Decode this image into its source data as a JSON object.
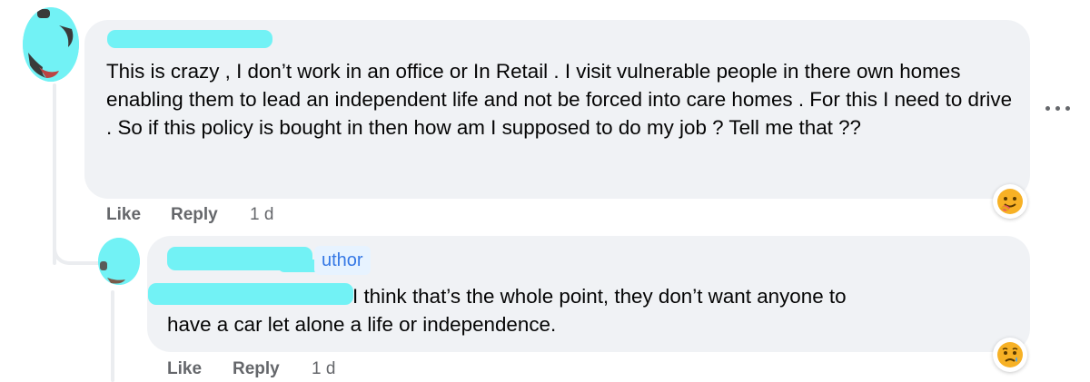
{
  "main_comment": {
    "text": "This is crazy , I don’t work in an office or In Retail . I visit vulnerable people in there own homes enabling them to lead an independent life and not be forced into care homes . For this I need to drive . So if this policy is bought in then how am I supposed to do my job ? Tell me that ??",
    "like_label": "Like",
    "reply_label": "Reply",
    "time": "1 d",
    "reaction_icon": "care-emoji-icon"
  },
  "reply_comment": {
    "badge": "uthor",
    "text_line1": "I think that’s the whole point, they don’t want anyone to",
    "text_line2": "have a car let alone a life or independence.",
    "like_label": "Like",
    "reply_label": "Reply",
    "time": "1 d",
    "reaction_icon": "sad-emoji-icon"
  },
  "more_icon": "more-options-icon",
  "colors": {
    "bubble": "#f0f2f5",
    "redaction": "#72f2f5",
    "secondary_text": "#65676b",
    "badge_bg": "#e7f3ff",
    "badge_text": "#3578e5"
  }
}
